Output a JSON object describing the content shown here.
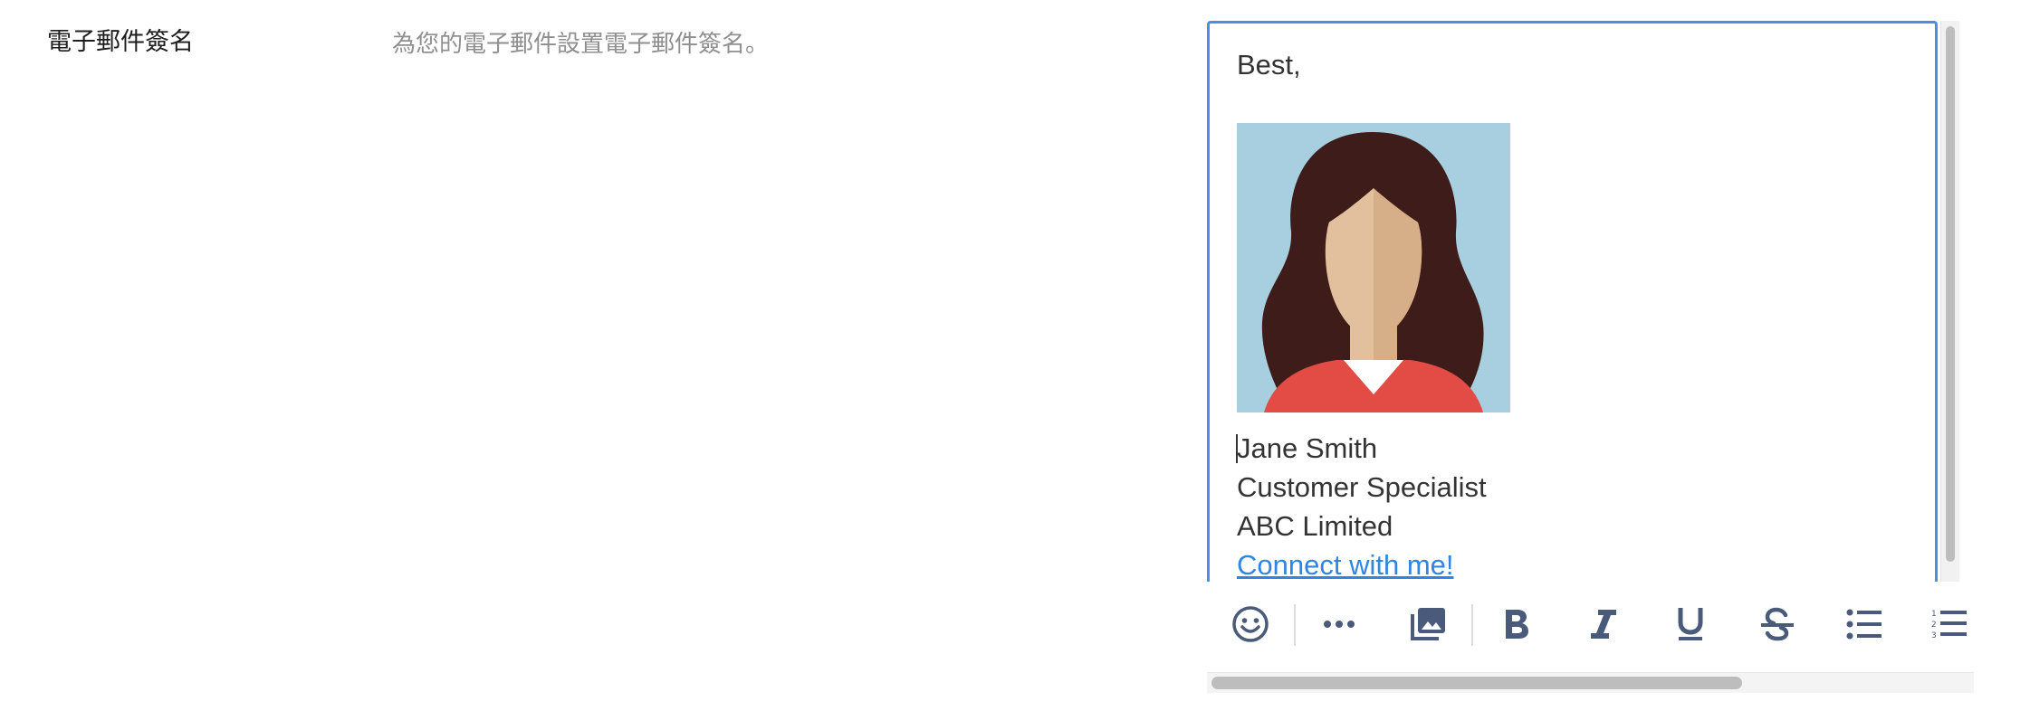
{
  "setting": {
    "label": "電子郵件簽名",
    "description": "為您的電子郵件設置電子郵件簽名。"
  },
  "signature": {
    "greeting": "Best,",
    "name": "Jane Smith",
    "title": "Customer Specialist",
    "company": "ABC Limited",
    "link_text": "Connect with me!",
    "photo_icon": "woman-avatar-photo"
  },
  "toolbar": {
    "buttons": [
      {
        "name": "emoji-icon"
      },
      {
        "name": "more-icon"
      },
      {
        "name": "image-icon"
      },
      {
        "name": "bold-icon"
      },
      {
        "name": "italic-icon"
      },
      {
        "name": "underline-icon"
      },
      {
        "name": "strikethrough-icon"
      },
      {
        "name": "bullet-list-icon"
      },
      {
        "name": "numbered-list-icon"
      }
    ]
  },
  "colors": {
    "editor_border": "#4a90e2",
    "link": "#2f86e0",
    "toolbar_icon": "#4a5a7a"
  }
}
